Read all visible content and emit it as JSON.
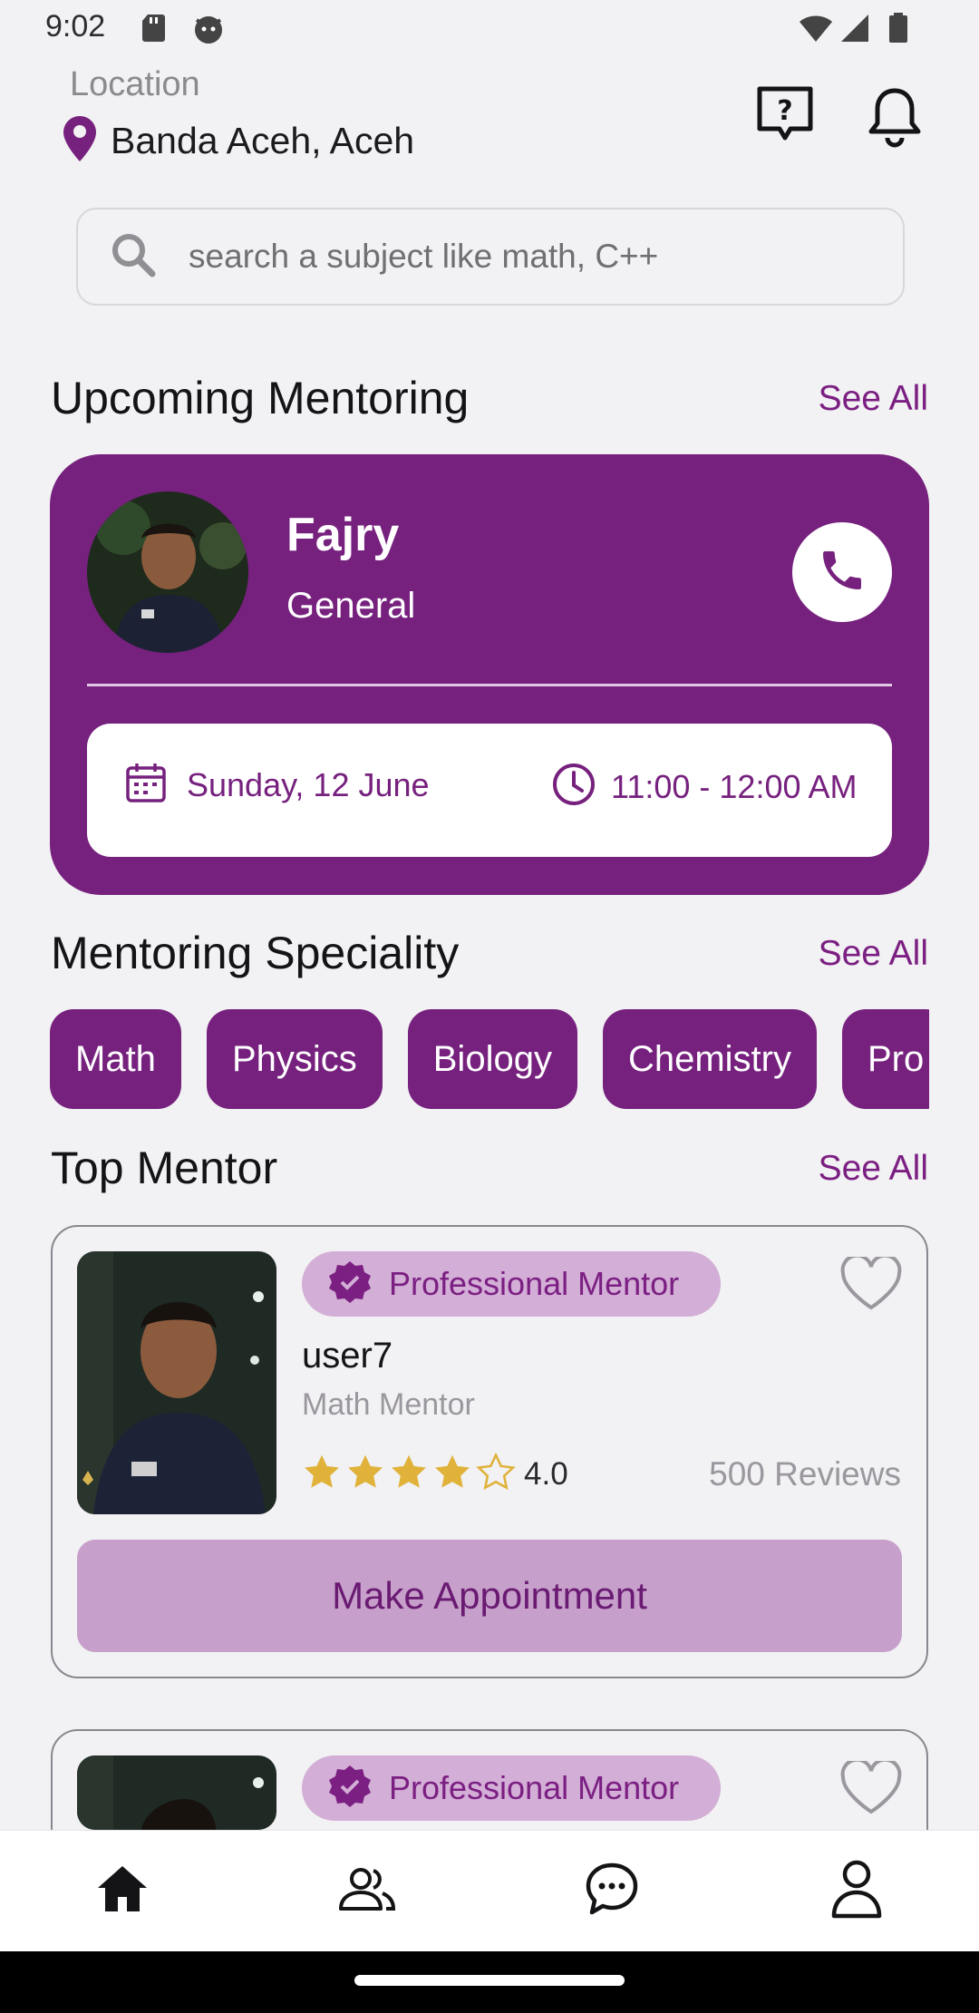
{
  "status_bar": {
    "time": "9:02"
  },
  "header": {
    "location_label": "Location",
    "location_value": "Banda Aceh, Aceh",
    "icons": [
      "help-chat-icon",
      "bell-icon"
    ]
  },
  "search": {
    "placeholder": "search a subject like math, C++"
  },
  "upcoming": {
    "title": "Upcoming Mentoring",
    "see_all": "See All",
    "mentor_name": "Fajry",
    "speciality": "General",
    "date": "Sunday, 12 June",
    "time": "11:00 - 12:00 AM"
  },
  "speciality": {
    "title": "Mentoring Speciality",
    "see_all": "See All",
    "chips": [
      "Math",
      "Physics",
      "Biology",
      "Chemistry",
      "Pro"
    ]
  },
  "top_mentor": {
    "title": "Top Mentor",
    "see_all": "See All",
    "cards": [
      {
        "badge": "Professional Mentor",
        "name": "user7",
        "role": "Math Mentor",
        "rating": "4.0",
        "stars_filled": 4,
        "reviews": "500 Reviews",
        "button": "Make Appointment"
      },
      {
        "badge": "Professional Mentor"
      }
    ]
  },
  "bottom_nav": [
    "home-icon",
    "people-icon",
    "chat-icon",
    "profile-icon"
  ],
  "colors": {
    "primary": "#76217e",
    "badge_bg": "#d3aed6",
    "button_bg": "#c6a0ca",
    "background": "#f2f1f3"
  }
}
